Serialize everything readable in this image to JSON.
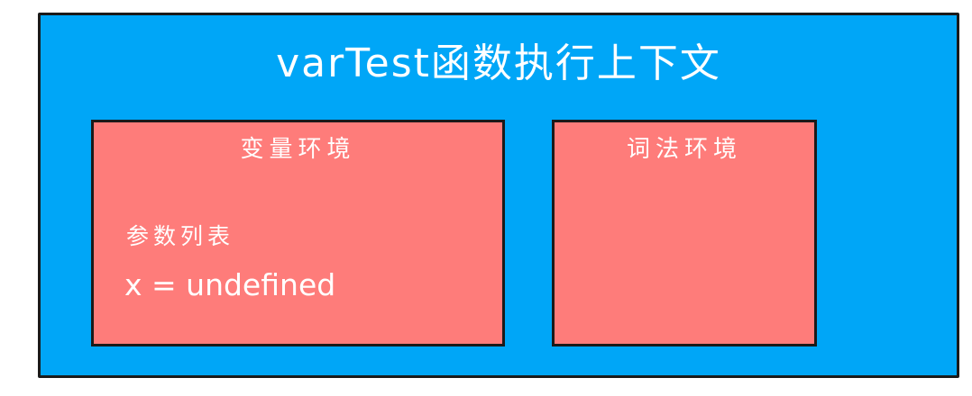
{
  "context": {
    "title": "varTest函数执行上下文",
    "variable_environment": {
      "title": "变量环境",
      "param_label": "参数列表",
      "param_value": "x = undefined"
    },
    "lexical_environment": {
      "title": "词法环境"
    }
  },
  "colors": {
    "context_bg": "#00a6f7",
    "environment_bg": "#fe7c7a",
    "border": "#1a1a1a",
    "text": "#ffffff"
  }
}
